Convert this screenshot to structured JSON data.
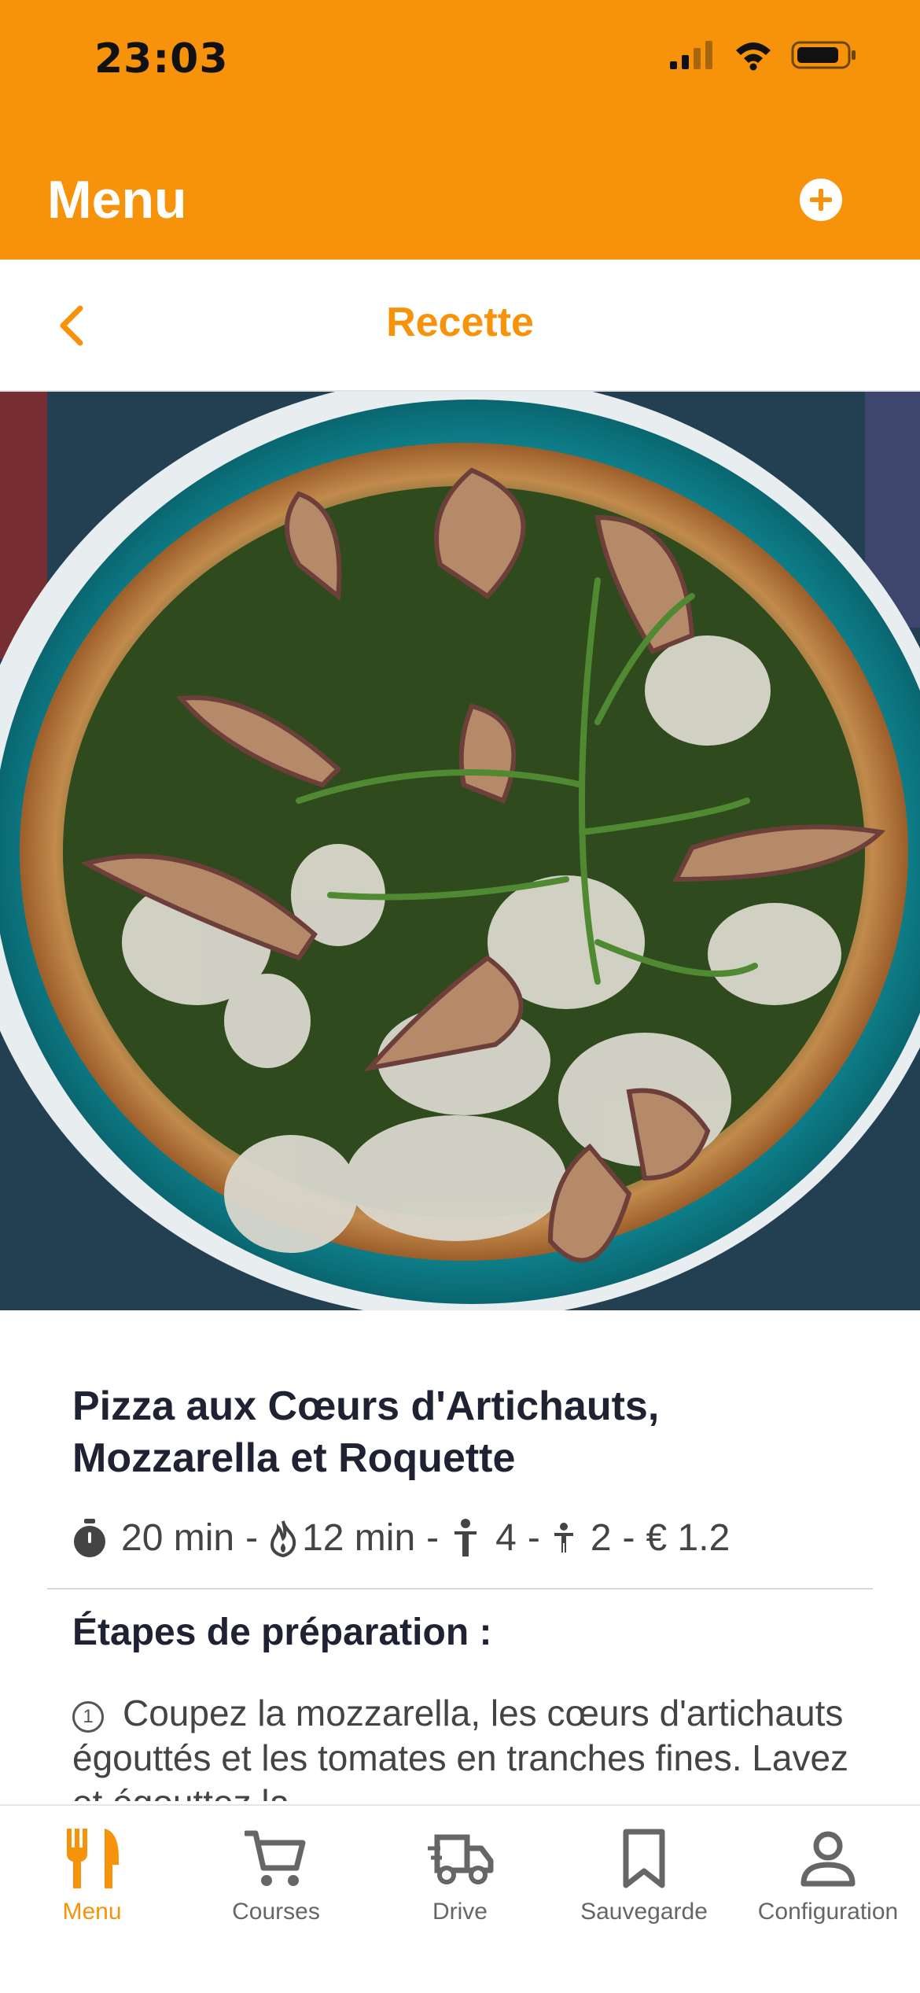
{
  "status_bar": {
    "time": "23:03"
  },
  "header": {
    "title": "Menu"
  },
  "nav": {
    "title": "Recette"
  },
  "recipe": {
    "title": "Pizza aux Cœurs d'Artichauts, Mozzarella et Roquette",
    "prep_time": "20 min",
    "cook_time": "12 min",
    "adults": "4",
    "children": "2",
    "price": "€ 1.2",
    "steps_heading": "Étapes de préparation :",
    "steps": [
      {
        "number": "1",
        "text": "Coupez la mozzarella, les cœurs d'artichauts égouttés et les tomates en tranches fines. Lavez et égouttez la"
      }
    ]
  },
  "tabbar": {
    "items": [
      {
        "label": "Menu",
        "icon": "fork-knife-icon",
        "active": true
      },
      {
        "label": "Courses",
        "icon": "cart-icon",
        "active": false
      },
      {
        "label": "Drive",
        "icon": "truck-icon",
        "active": false
      },
      {
        "label": "Sauvegarde",
        "icon": "bookmark-icon",
        "active": false
      },
      {
        "label": "Configuration",
        "icon": "user-icon",
        "active": false
      }
    ]
  },
  "colors": {
    "accent": "#f7930a",
    "text": "#1f2233",
    "muted": "#444444"
  }
}
